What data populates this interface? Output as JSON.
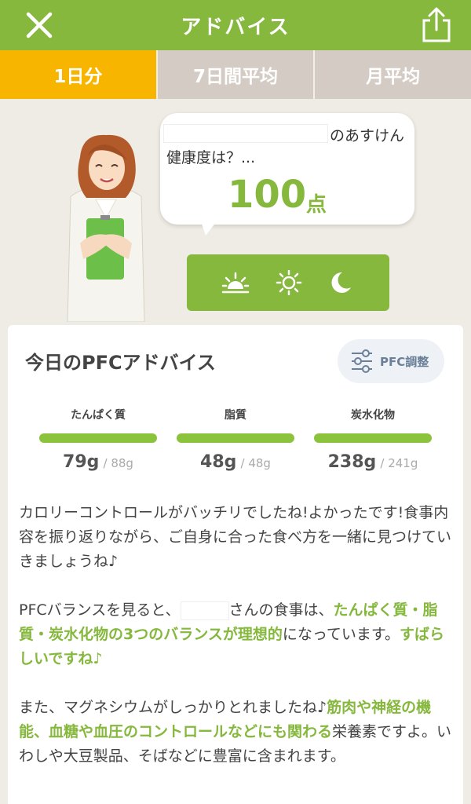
{
  "header": {
    "title": "アドバイス"
  },
  "tabs": [
    "1日分",
    "7日間平均",
    "月平均"
  ],
  "bubble": {
    "suffix": "のあすけん",
    "question": "健康度は？...",
    "score": "100",
    "score_unit": "点"
  },
  "card": {
    "title": "今日のPFCアドバイス",
    "pfc_button": "PFC調整",
    "nutrients": [
      {
        "name": "たんぱく質",
        "value": "79g",
        "target": "/ 88g"
      },
      {
        "name": "脂質",
        "value": "48g",
        "target": "/ 48g"
      },
      {
        "name": "炭水化物",
        "value": "238g",
        "target": "/ 241g"
      }
    ],
    "advice": {
      "p1": "カロリーコントロールがバッチリでしたね!よかったです!食事内容を振り返りながら、ご自身に合った食べ方を一緒に見つけていきましょうね♪",
      "p2_a": "PFCバランスを見ると、",
      "p2_b": "さんの食事は、",
      "p2_c": "たんぱく質・脂質・炭水化物の3つのバランスが理想的",
      "p2_d": "になっています。",
      "p2_e": "すばらしいですね♪",
      "p3_a": "また、マグネシウムがしっかりとれましたね♪",
      "p3_b": "筋肉や神経の機能、血糖や血圧のコントロールなどにも関わる",
      "p3_c": "栄養素ですよ。いわしや大豆製品、そばなどに豊富に含まれます。"
    }
  },
  "colors": {
    "brand_green": "#85b83d",
    "active_tab": "#f7b500",
    "inactive_tab": "#d4ccc4"
  }
}
